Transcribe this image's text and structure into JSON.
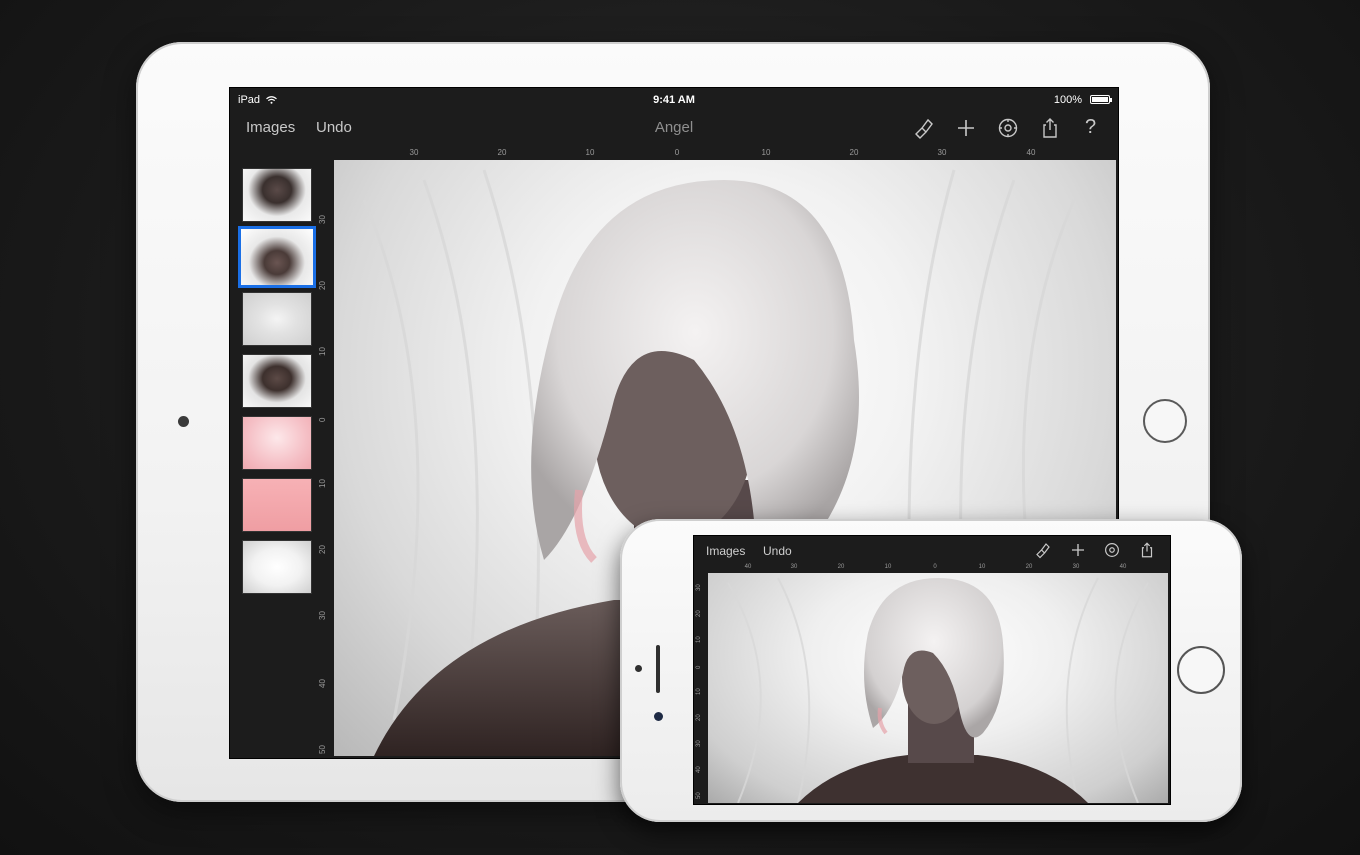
{
  "ipad": {
    "status": {
      "device": "iPad",
      "time": "9:41 AM",
      "battery": "100%"
    },
    "nav": {
      "images_label": "Images",
      "undo_label": "Undo",
      "title": "Angel"
    },
    "toolbar_icons": [
      "brush-icon",
      "plus-icon",
      "settings-icon",
      "share-icon",
      "help-icon"
    ],
    "help_glyph": "?",
    "ruler_top": [
      "30",
      "20",
      "10",
      "0",
      "10",
      "20",
      "30",
      "40"
    ],
    "ruler_left": [
      "30",
      "20",
      "10",
      "0",
      "10",
      "20",
      "30",
      "40",
      "50"
    ],
    "layers_selected_index": 1
  },
  "iphone": {
    "nav": {
      "images_label": "Images",
      "undo_label": "Undo"
    },
    "toolbar_icons": [
      "brush-icon",
      "plus-icon",
      "settings-icon",
      "share-icon"
    ],
    "ruler_top": [
      "40",
      "30",
      "20",
      "10",
      "0",
      "10",
      "20",
      "30",
      "40"
    ],
    "ruler_left": [
      "30",
      "20",
      "10",
      "0",
      "10",
      "20",
      "30",
      "40",
      "50"
    ]
  },
  "colors": {
    "selection": "#1a6fe6",
    "ui_background": "#1c1c1c"
  }
}
